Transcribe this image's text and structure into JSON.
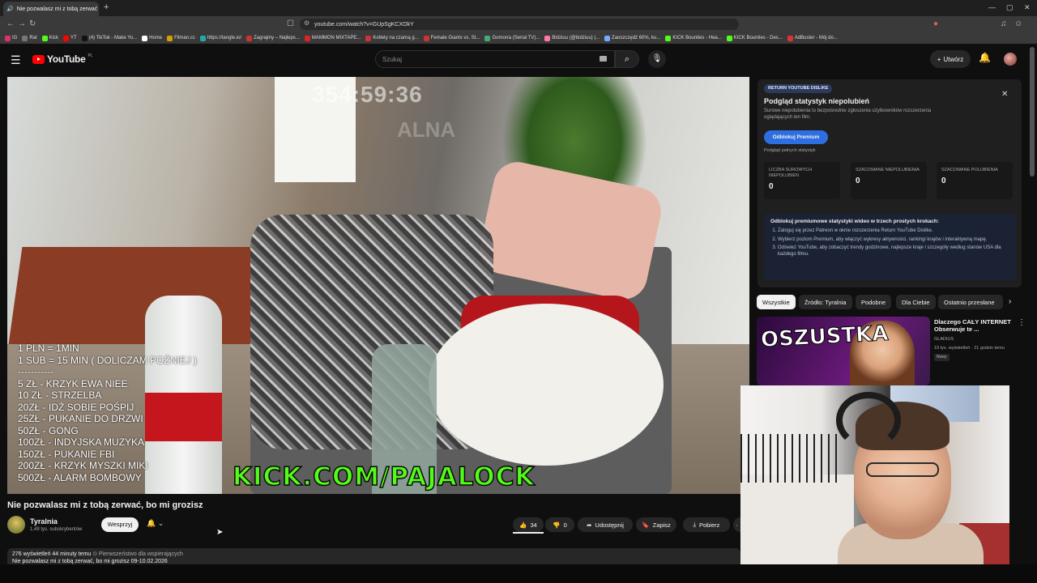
{
  "browser": {
    "tab_title": "Nie pozwalasz mi z tobą zerwać",
    "url": "youtube.com/watch?v=GUpSgKCXOkY",
    "bookmarks": [
      "IG",
      "Rat",
      "Kick",
      "YT",
      "(4) TikTok - Make Yo...",
      "Home",
      "Filman.cc",
      "https://tangle.io/",
      "Zagrajmy – Najleps...",
      "MAMMON MIXTAPE...",
      "Kotlety na czarną g...",
      "Female Giants vs. St...",
      "Gomorra (Serial TV)...",
      "Bidziuu (@bidziuu) |...",
      "Zaoszczędź 60%, ku...",
      "KICK Bounties - Hea...",
      "KICK Bounties - Des...",
      "AdBuster - Mój do..."
    ]
  },
  "header": {
    "logo_text": "YouTube",
    "logo_region": "PL",
    "search_placeholder": "Szukaj",
    "create_label": "Utwórz"
  },
  "video": {
    "overlay_timer": "354:59:36",
    "overlay_faded": "ALNA",
    "donation_lines": [
      "1 PLN = 1MIN",
      "1 SUB = 15 MIN ( DOLICZAM POŹNIEJ )",
      "-----------",
      "5 ZŁ - KRZYK EWA NIEE",
      "10 ZŁ - STRZELBA",
      "20ZŁ - IDŹ SOBIE POŚPIJ",
      "25ZŁ - PUKANIE DO DRZWI",
      "50ZŁ - GONG",
      "100ZŁ - INDYJSKA MUZYKA",
      "150ZŁ - PUKANIE FBI",
      "200ZŁ - KRZYK MYSZKI MIKI",
      "500ZŁ - ALARM BOMBOWY"
    ],
    "kick_banner": "KICK.COM/PAJALOCK"
  },
  "watch": {
    "title": "Nie pozwalasz mi z tobą zerwać, bo mi grozisz",
    "channel": "Tyralnia",
    "subscribers": "1,49 tys. subskrybentów",
    "support_label": "Wesprzyj",
    "likes": "34",
    "dislikes": "0",
    "share_label": "Udostępnij",
    "save_label": "Zapisz",
    "download_label": "Pobierz",
    "desc_meta": "276 wyświetleń  44 minuty temu",
    "desc_priority": "Pierwszeństwo dla wspierających",
    "desc_line2": "Nie pozwalasz mi z tobą zerwać, bo mi grozisz  09-10.02.2026"
  },
  "ryd": {
    "badge": "RETURN YOUTUBE DISLIKE",
    "title": "Podgląd statystyk niepolubień",
    "desc": "Surowe niepolubienia to bezpośrednie zgłoszenia użytkowników rozszerzenia oglądających ten film.",
    "unlock_label": "Odblokuj Premium",
    "full_stats": "Podgląd pełnych statystyk",
    "stats": [
      {
        "label": "LICZBA SUROWYCH NIEPOLUBIEŃ",
        "value": "0"
      },
      {
        "label": "SZACOWANE NIEPOLUBIENIA",
        "value": "0"
      },
      {
        "label": "SZACOWANE POLUBIENIA",
        "value": "0"
      }
    ],
    "steps_title": "Odblokuj premiumowe statystyki wideo w trzech prostych krokach:",
    "steps": [
      "Zaloguj się przez Patreon w oknie rozszerzenia Return YouTube Dislike.",
      "Wybierz poziom Premium, aby włączyć wykresy aktywności, rankingi krajów i interaktywną mapę.",
      "Odśwież YouTube, aby zobaczyć trendy godzinowe, najlepsze kraje i szczegóły według stanów USA dla każdego filmu."
    ]
  },
  "chips": [
    "Wszystkie",
    "Źródło: Tyralnia",
    "Podobne",
    "Dla Ciebie",
    "Ostatnio przesłane"
  ],
  "recommended": {
    "thumb_text": "OSZUSTKA",
    "title": "Dlaczego CAŁY INTERNET Obserwuje te ...",
    "channel": "GLADIUS",
    "meta": "19 tys. wyświetleń · 21 godzin temu",
    "badge": "Nowy"
  }
}
